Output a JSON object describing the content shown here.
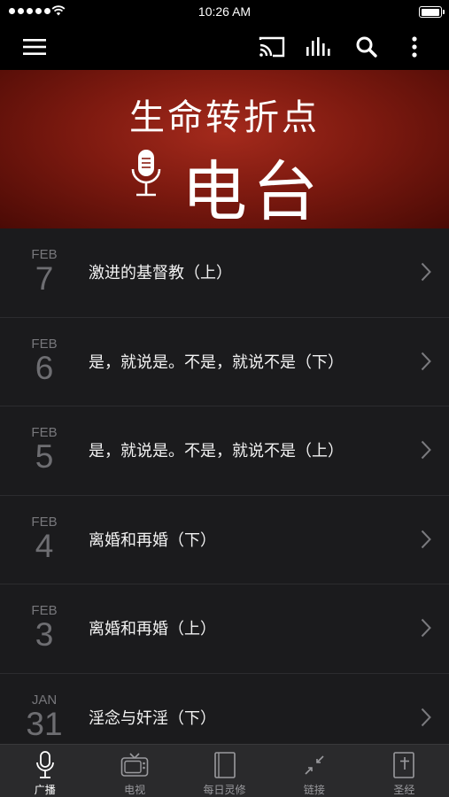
{
  "status_bar": {
    "time": "10:26 AM"
  },
  "toolbar": {
    "menu_icon": "hamburger-menu-icon",
    "cast_icon": "cast-icon",
    "audio_icon": "audio-levels-icon",
    "search_icon": "search-icon",
    "more_icon": "more-vertical-icon"
  },
  "banner": {
    "title": "生命转折点",
    "subtitle": "电台",
    "icon": "microphone-icon",
    "colors": {
      "center": "#a42a1c",
      "edge": "#4a0a05"
    }
  },
  "episodes": [
    {
      "month": "FEB",
      "day": "7",
      "title": "激进的基督教（上）"
    },
    {
      "month": "FEB",
      "day": "6",
      "title": "是，就说是。不是，就说不是（下）"
    },
    {
      "month": "FEB",
      "day": "5",
      "title": "是，就说是。不是，就说不是（上）"
    },
    {
      "month": "FEB",
      "day": "4",
      "title": "离婚和再婚（下）"
    },
    {
      "month": "FEB",
      "day": "3",
      "title": "离婚和再婚（上）"
    },
    {
      "month": "JAN",
      "day": "31",
      "title": "淫念与奸淫（下）"
    }
  ],
  "tabs": [
    {
      "label": "广播",
      "icon": "microphone-icon",
      "active": true
    },
    {
      "label": "电视",
      "icon": "tv-icon",
      "active": false
    },
    {
      "label": "每日灵修",
      "icon": "book-icon",
      "active": false
    },
    {
      "label": "链接",
      "icon": "link-icon",
      "active": false
    },
    {
      "label": "圣经",
      "icon": "bible-icon",
      "active": false
    }
  ]
}
